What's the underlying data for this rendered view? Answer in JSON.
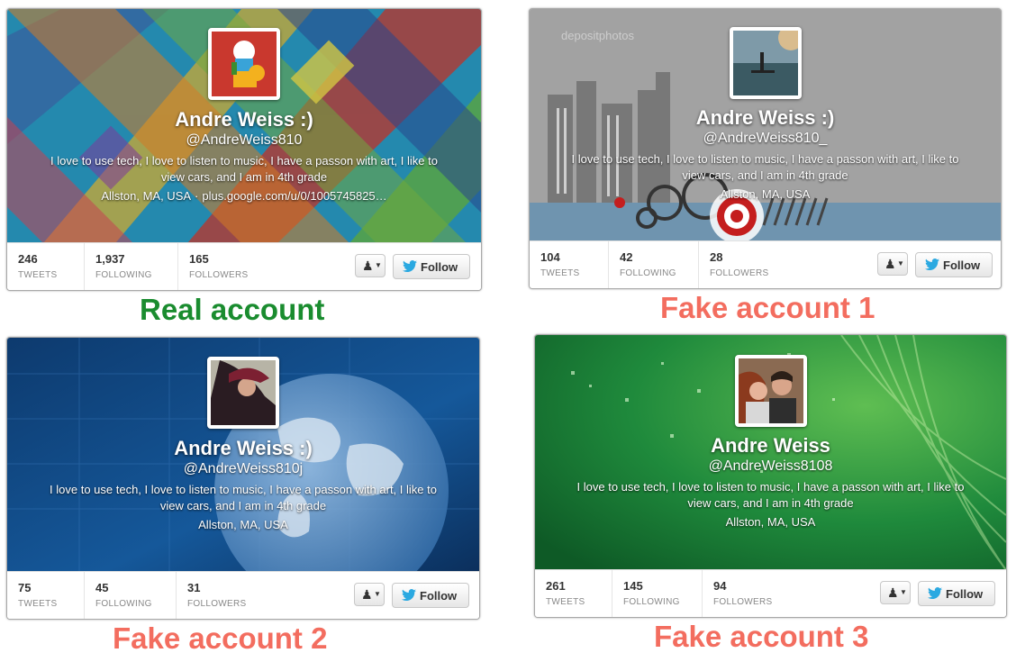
{
  "panels": [
    {
      "name": "Andre Weiss :)",
      "handle": "@AndreWeiss810",
      "bio": "I love to use tech, I love to listen to music, I have a passon with art, I like to view cars, and I am in 4th grade",
      "location": "Allston, MA, USA",
      "separator": "·",
      "url": "plus.google.com/u/0/1005745825…",
      "tweets": "246",
      "following": "1,937",
      "followers": "165",
      "caption": "Real account"
    },
    {
      "name": "Andre Weiss :)",
      "handle": "@AndreWeiss810_",
      "bio": "I love to use tech, I love to listen to music, I have a passon with art, I like to view cars, and I am in 4th grade",
      "location": "Allston, MA, USA",
      "tweets": "104",
      "following": "42",
      "followers": "28",
      "caption": "Fake account 1",
      "watermark": "depositphotos"
    },
    {
      "name": "Andre Weiss :)",
      "handle": "@AndreWeiss810j",
      "bio": "I love to use tech, I love to listen to music, I have a passon with art, I like to view cars, and I am in 4th grade",
      "location": "Allston, MA, USA",
      "tweets": "75",
      "following": "45",
      "followers": "31",
      "caption": "Fake account 2"
    },
    {
      "name": "Andre Weiss",
      "handle": "@AndreWeiss8108",
      "bio": "I love to use tech, I love to listen to music, I have a passon with art, I like to view cars, and I am in 4th grade",
      "location": "Allston, MA, USA",
      "tweets": "261",
      "following": "145",
      "followers": "94",
      "caption": "Fake account 3"
    }
  ],
  "labels": {
    "tweets": "TWEETS",
    "following": "FOLLOWING",
    "followers": "FOLLOWERS",
    "follow": "Follow"
  },
  "icons": {
    "user_menu": "user-dropdown-icon",
    "follow": "twitter-bird-icon"
  },
  "colors": {
    "caption_real": "#1a8c2f",
    "caption_fake": "#f36d5f",
    "twitter_blue": "#2ba9e1"
  }
}
